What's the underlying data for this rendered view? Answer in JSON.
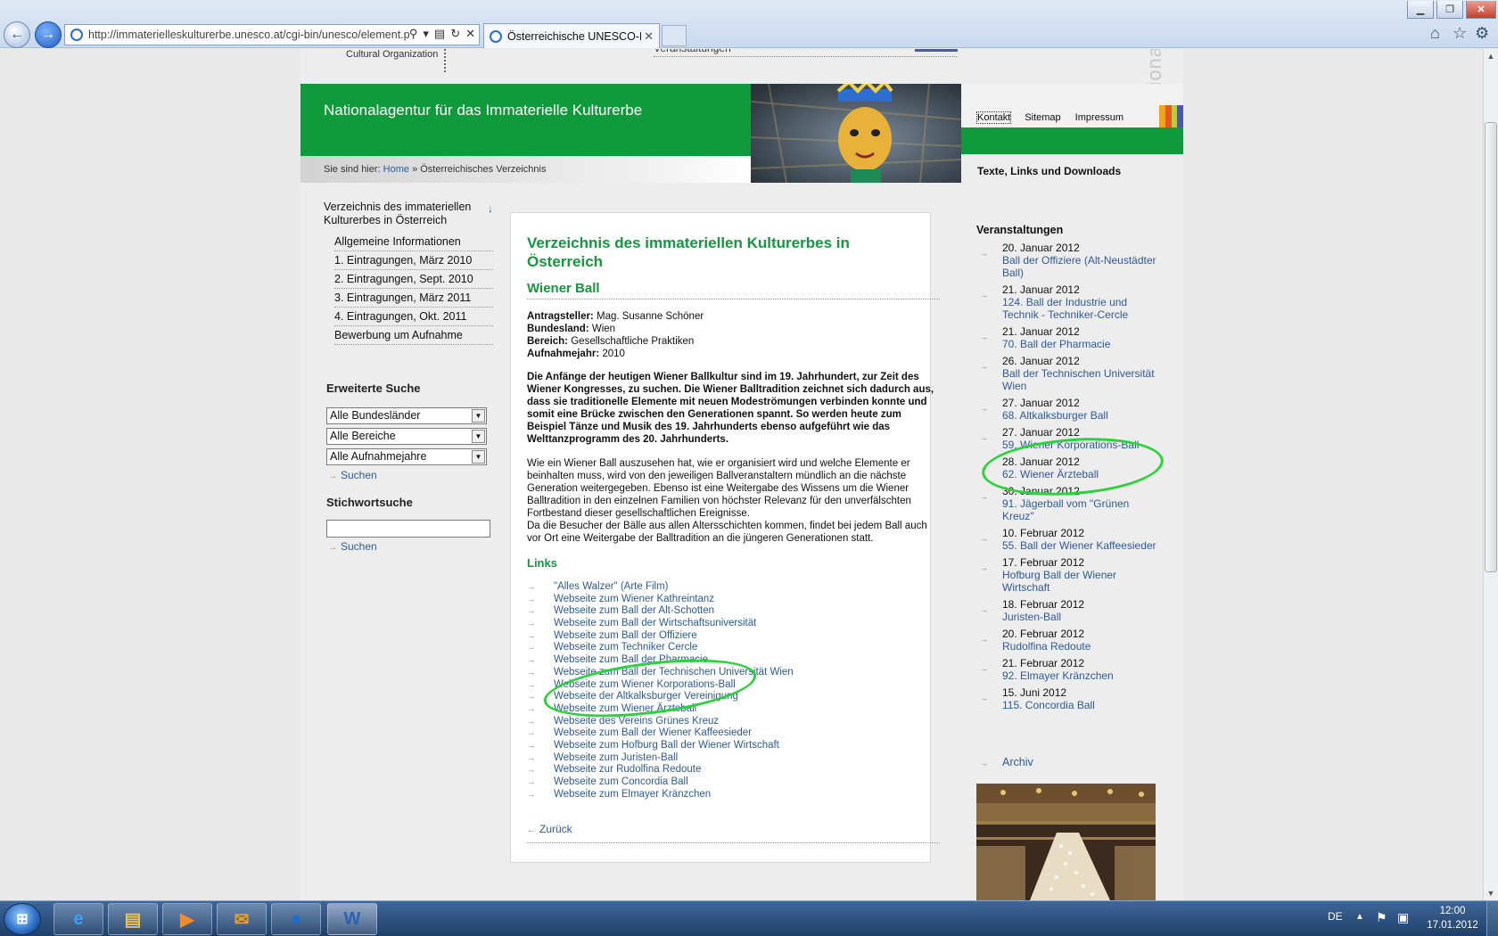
{
  "browser": {
    "url": "http://immaterielleskulturerbe.unesco.at/cgi-bin/unesco/element.p",
    "tab_title": "Österreichische UNESCO-K...",
    "icons": [
      "back-icon",
      "forward-icon",
      "search-icon",
      "refresh-icon",
      "stop-icon",
      "home-icon",
      "star-icon",
      "gear-icon"
    ]
  },
  "header": {
    "org_line": "Cultural Organization",
    "top_tab_fragment": "Veranstaltungen",
    "vertical_text": "nationa",
    "site_title": "Nationalagentur für das Immaterielle Kulturerbe",
    "breadcrumb_prefix": "Sie sind hier:",
    "breadcrumb_home": "Home",
    "breadcrumb_sep": "»",
    "breadcrumb_current": "Österreichisches Verzeichnis",
    "toplinks": [
      "Kontakt",
      "Sitemap",
      "Impressum"
    ],
    "downloads": "Texte, Links und Downloads",
    "stripe_colors": [
      "#f4a11a",
      "#e45a1e",
      "#b5cf3a",
      "#4a5aa8"
    ]
  },
  "leftnav": {
    "title": "Verzeichnis des immateriellen Kulturerbes in Österreich",
    "arrow": "↓",
    "items": [
      "Allgemeine Informationen",
      "1. Eintragungen, März 2010",
      "2. Eintragungen, Sept. 2010",
      "3. Eintragungen, März 2011",
      "4. Eintragungen, Okt. 2011",
      "Bewerbung um Aufnahme"
    ]
  },
  "search": {
    "heading": "Erweiterte Suche",
    "select_land": "Alle Bundesländer",
    "select_bereich": "Alle Bereiche",
    "select_jahr": "Alle Aufnahmejahre",
    "search_label": "Suchen",
    "kw_heading": "Stichwortsuche",
    "kw_value": "",
    "search_label_2": "Suchen"
  },
  "main": {
    "title": "Verzeichnis des immateriellen Kulturerbes in Österreich",
    "entry": "Wiener Ball",
    "meta": {
      "antragsteller_label": "Antragsteller:",
      "antragsteller": "Mag. Susanne Schöner",
      "bundesland_label": "Bundesland:",
      "bundesland": "Wien",
      "bereich_label": "Bereich:",
      "bereich": "Gesellschaftliche Praktiken",
      "jahr_label": "Aufnahmejahr:",
      "jahr": "2010"
    },
    "lead": "Die Anfänge der heutigen Wiener Ballkultur sind im 19. Jahrhundert, zur Zeit des Wiener Kongresses, zu suchen. Die Wiener Balltradition zeichnet sich dadurch aus, dass sie traditionelle Elemente mit neuen Modeströmungen verbinden konnte und somit eine Brücke zwischen den Generationen spannt. So werden heute zum Beispiel Tänze und Musik des 19. Jahrhunderts ebenso aufgeführt wie das Welttanzprogramm des 20. Jahrhunderts.",
    "body1": "Wie ein Wiener Ball auszusehen hat, wie er organisiert wird und welche Elemente er beinhalten muss, wird von den jeweiligen Ballveranstaltern mündlich an die nächste Generation weitergegeben. Ebenso ist eine Weitergabe des Wissens um die Wiener Balltradition in den einzelnen Familien von höchster Relevanz für den unverfälschten Fortbestand dieser gesellschaftlichen Ereignisse.",
    "body2": "Da die Besucher der Bälle aus allen Altersschichten kommen, findet bei jedem Ball auch vor Ort eine Weitergabe der Balltradition an die jüngeren Generationen statt.",
    "links_heading": "Links",
    "links": [
      "\"Alles Walzer\" (Arte Film)",
      "Webseite zum Wiener Kathreintanz",
      "Webseite zum Ball der Alt-Schotten",
      "Webseite zum Ball der Wirtschaftsuniversität",
      "Webseite zum Ball der Offiziere",
      "Webseite zum Techniker Cercle",
      "Webseite zum Ball der Pharmacie",
      "Webseite zum Ball der Technischen Universität Wien",
      "Webseite zum Wiener Korporations-Ball",
      "Webseite der Altkalksburger Vereinigung",
      "Webseite zum Wiener Ärzteball",
      "Webseite des Vereins Grünes Kreuz",
      "Webseite zum Ball der Wiener Kaffeesieder",
      "Webseite zum Hofburg Ball der Wiener Wirtschaft",
      "Webseite zum Juristen-Ball",
      "Webseite zur Rudolfina Redoute",
      "Webseite zum Concordia Ball",
      "Webseite zum Elmayer Kränzchen"
    ],
    "back": "Zurück"
  },
  "events": {
    "heading": "Veranstaltungen",
    "items": [
      {
        "date": "20. Januar 2012",
        "name": "Ball der Offiziere (Alt-Neustädter Ball)"
      },
      {
        "date": "21. Januar 2012",
        "name": "124. Ball der Industrie und Technik - Techniker-Cercle"
      },
      {
        "date": "21. Januar 2012",
        "name": "70. Ball der Pharmacie"
      },
      {
        "date": "26. Januar 2012",
        "name": "Ball der Technischen Universität Wien"
      },
      {
        "date": "27. Januar 2012",
        "name": "68. Altkalksburger Ball"
      },
      {
        "date": "27. Januar 2012",
        "name": "59. Wiener Korporations-Ball"
      },
      {
        "date": "28. Januar 2012",
        "name": "62. Wiener Ärzteball"
      },
      {
        "date": "30. Januar 2012",
        "name": "91. Jägerball vom \"Grünen Kreuz\""
      },
      {
        "date": "10. Februar 2012",
        "name": "55. Ball der Wiener Kaffeesieder"
      },
      {
        "date": "17. Februar 2012",
        "name": "Hofburg Ball der Wiener Wirtschaft"
      },
      {
        "date": "18. Februar 2012",
        "name": "Juristen-Ball"
      },
      {
        "date": "20. Februar 2012",
        "name": "Rudolfina Redoute"
      },
      {
        "date": "21. Februar 2012",
        "name": "92. Elmayer Kränzchen"
      },
      {
        "date": "15. Juni 2012",
        "name": "115. Concordia Ball"
      }
    ],
    "archiv": "Archiv"
  },
  "taskbar": {
    "lang": "DE",
    "time": "12:00",
    "date": "17.01.2012"
  },
  "colors": {
    "brand_green": "#0f9a3b",
    "heading_green": "#14973e",
    "link_blue": "#2d5a9a",
    "annotation_green": "#2bd33a"
  }
}
